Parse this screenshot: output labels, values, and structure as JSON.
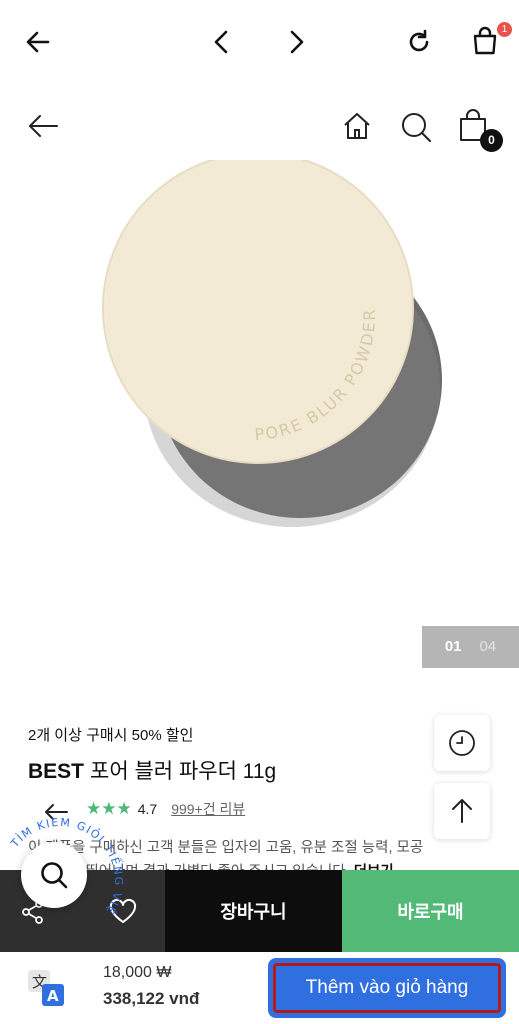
{
  "browser": {
    "cart_count": "1",
    "icons": [
      "back-arrow-icon",
      "chevron-left-icon",
      "chevron-right-icon",
      "reload-icon",
      "shopping-bag-icon"
    ]
  },
  "site_header": {
    "cart_count": "0",
    "icons": [
      "back-arrow-icon",
      "home-icon",
      "search-icon",
      "shopping-bag-icon"
    ]
  },
  "product_image": {
    "embossed_text": "PORE BLUR POWDER",
    "pager_current": "01",
    "pager_total": "04"
  },
  "product": {
    "promo": "2개 이상 구매시 50% 할인",
    "badge": "BEST",
    "name": "포어 블러 파우더 11g",
    "rating": "4.7",
    "reviews": "999+건 리뷰",
    "desc_line1": "이 제품을 구매하신 고객 분들은 입자의 고움, 유분 조절 능력, 모공",
    "desc_line2": "커버력이 뛰어나며 결과 가볍다 좋아 주시고 있습니다.",
    "desc_bold": "더보기"
  },
  "actions": {
    "cart_label": "장바구니",
    "buy_label": "바로구매"
  },
  "overlay": {
    "arc_text": "TÌM KIẾM GIỎI TIẾNG VIỆT"
  },
  "translate_bar": {
    "price_krw": "18,000 ₩",
    "price_vnd": "338,122 vnđ",
    "add_to_cart": "Thêm vào giỏ hàng"
  },
  "colors": {
    "buy_green": "#52b977",
    "cart_black": "#0d0d0d",
    "star_green": "#4cb878",
    "add_cart_blue": "#2f6fe0",
    "highlight_red": "#b31b1b",
    "badge_red": "#e8534a"
  }
}
